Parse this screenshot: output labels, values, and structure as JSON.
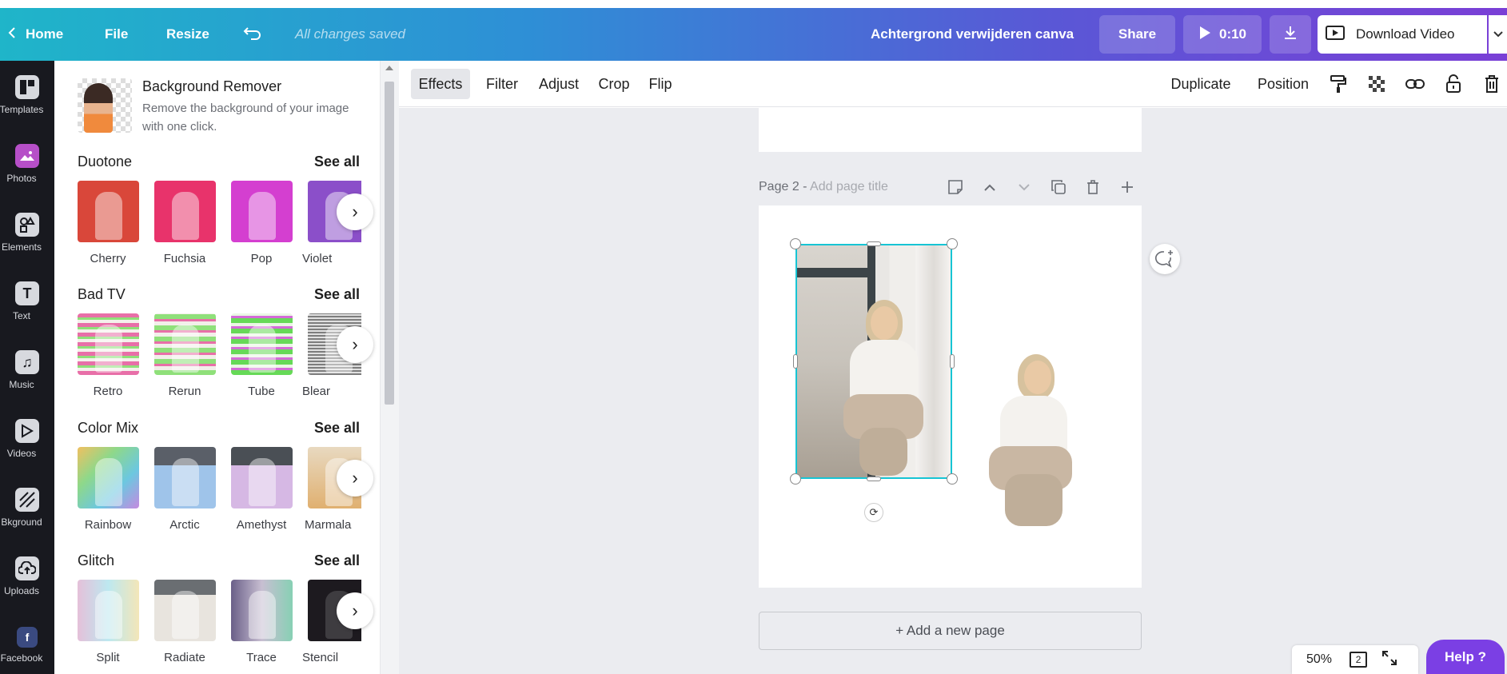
{
  "topbar": {
    "home_label": "Home",
    "file_label": "File",
    "resize_label": "Resize",
    "saved_status": "All changes saved",
    "doc_title": "Achtergrond verwijderen canva",
    "share_label": "Share",
    "play_time": "0:10",
    "download_video_label": "Download Video"
  },
  "rail": {
    "items": [
      {
        "label": "Templates",
        "icon": "templates-icon"
      },
      {
        "label": "Photos",
        "icon": "photos-icon"
      },
      {
        "label": "Elements",
        "icon": "elements-icon"
      },
      {
        "label": "Text",
        "icon": "text-icon"
      },
      {
        "label": "Music",
        "icon": "music-icon"
      },
      {
        "label": "Videos",
        "icon": "videos-icon"
      },
      {
        "label": "Bkground",
        "icon": "background-icon"
      },
      {
        "label": "Uploads",
        "icon": "uploads-icon"
      },
      {
        "label": "Facebook",
        "icon": "facebook-icon"
      }
    ]
  },
  "panel": {
    "bg_remover": {
      "title": "Background Remover",
      "description": "Remove the background of your image with one click."
    },
    "sections": [
      {
        "title": "Duotone",
        "see_all": "See all",
        "effects": [
          "Cherry",
          "Fuchsia",
          "Pop",
          "Violet"
        ],
        "colors": [
          "#d9473a",
          "#e8336b",
          "#d43fd0",
          "#8b4fc9"
        ]
      },
      {
        "title": "Bad TV",
        "see_all": "See all",
        "effects": [
          "Retro",
          "Rerun",
          "Tube",
          "Blear"
        ],
        "colors": [
          "#e86fa8",
          "#8fe07a",
          "#66d957",
          "#7d7d7d"
        ]
      },
      {
        "title": "Color Mix",
        "see_all": "See all",
        "effects": [
          "Rainbow",
          "Arctic",
          "Amethyst",
          "Marmala"
        ],
        "colors": [
          "#7fd0a0",
          "#7fa7d8",
          "#c59bd8",
          "#e0b070"
        ]
      },
      {
        "title": "Glitch",
        "see_all": "See all",
        "effects": [
          "Split",
          "Radiate",
          "Trace",
          "Stencil"
        ],
        "colors": [
          "#c9b9d9",
          "#d8d2cc",
          "#b9a8c9",
          "#2a2328"
        ]
      }
    ]
  },
  "toolbar": {
    "effects": "Effects",
    "filter": "Filter",
    "adjust": "Adjust",
    "crop": "Crop",
    "flip": "Flip",
    "duplicate": "Duplicate",
    "position": "Position"
  },
  "canvas": {
    "page_label": "Page 2 - ",
    "page_title_placeholder": "Add page title",
    "add_page": "+ Add a new page"
  },
  "footer": {
    "zoom": "50%",
    "page_count": "2",
    "help": "Help ?"
  }
}
